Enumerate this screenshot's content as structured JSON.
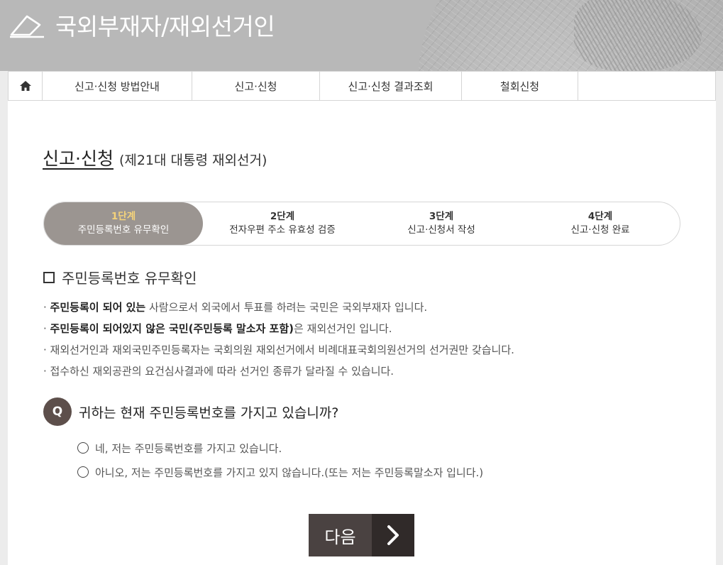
{
  "header": {
    "title": "국외부재자/재외선거인"
  },
  "nav": {
    "home_icon": "home-icon",
    "items": [
      {
        "label": "신고·신청 방법안내"
      },
      {
        "label": "신고·신청"
      },
      {
        "label": "신고·신청 결과조회"
      },
      {
        "label": "철회신청"
      }
    ]
  },
  "page": {
    "title": "신고·신청",
    "subtitle": "(제21대 대통령 재외선거)"
  },
  "steps": [
    {
      "num": "1단계",
      "label": "주민등록번호 유무확인",
      "active": true
    },
    {
      "num": "2단계",
      "label": "전자우편 주소 유효성 검증",
      "active": false
    },
    {
      "num": "3단계",
      "label": "신고·신청서 작성",
      "active": false
    },
    {
      "num": "4단계",
      "label": "신고·신청 완료",
      "active": false
    }
  ],
  "section": {
    "heading": "주민등록번호 유무확인",
    "bullets": [
      {
        "bold": "주민등록이 되어 있는",
        "rest": " 사람으로서 외국에서 투표를 하려는 국민은 국외부재자 입니다."
      },
      {
        "bold": "주민등록이 되어있지 않은 국민(주민등록 말소자 포함)",
        "rest": "은 재외선거인 입니다."
      },
      {
        "bold": "",
        "rest": "재외선거인과 재외국민주민등록자는 국회의원 재외선거에서 비례대표국회의원선거의 선거권만 갖습니다."
      },
      {
        "bold": "",
        "rest": "접수하신 재외공관의 요건심사결과에 따라 선거인 종류가 달라질 수 있습니다."
      }
    ]
  },
  "question": {
    "badge": "Q",
    "text": "귀하는 현재 주민등록번호를 가지고 있습니까?",
    "options": [
      "네, 저는 주민등록번호를 가지고 있습니다.",
      "아니오, 저는 주민등록번호를 가지고 있지 않습니다.(또는 저는 주민등록말소자 입니다.)"
    ]
  },
  "next_button": {
    "label": "다음"
  },
  "colors": {
    "active_step": "#9b9591",
    "active_step_num": "#f5d37a",
    "q_badge": "#5d4f4b",
    "button": "#4a4241",
    "button_arrow": "#302a29"
  }
}
